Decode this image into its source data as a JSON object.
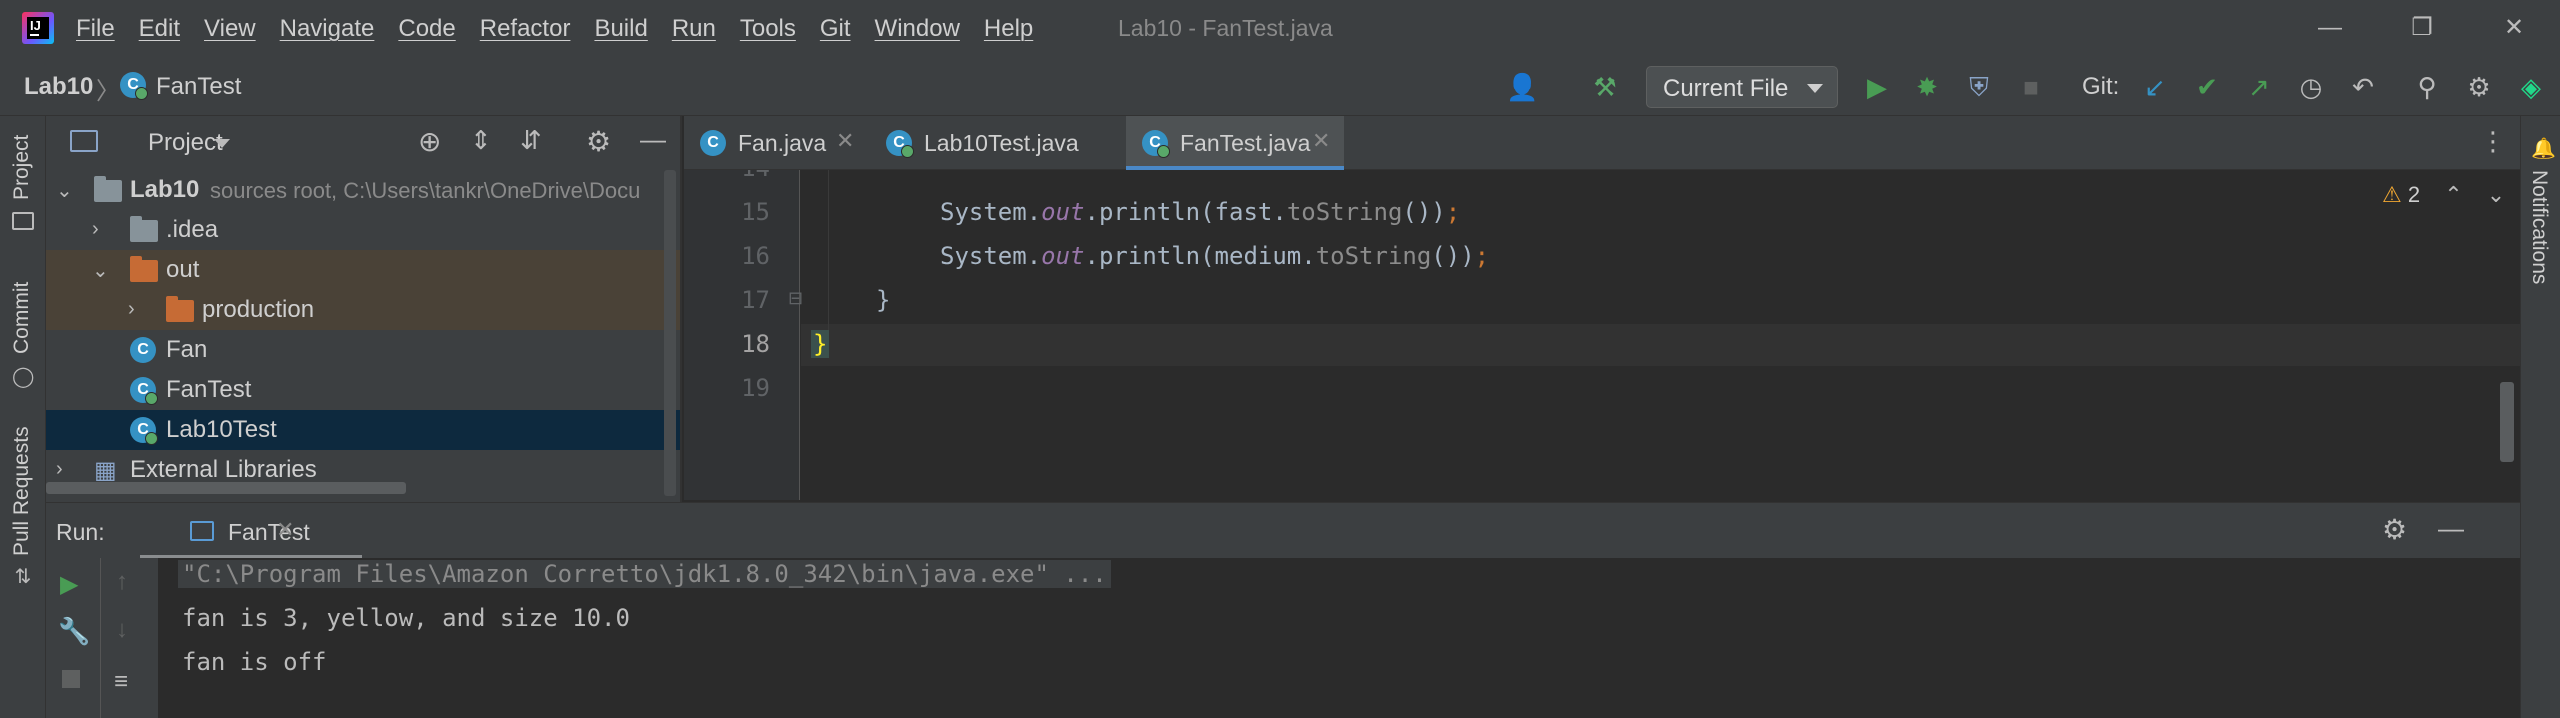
{
  "window": {
    "title": "Lab10 - FanTest.java",
    "menu": [
      "File",
      "Edit",
      "View",
      "Navigate",
      "Code",
      "Refactor",
      "Build",
      "Run",
      "Tools",
      "Git",
      "Window",
      "Help"
    ]
  },
  "navbar": {
    "project": "Lab10",
    "file": "FanTest",
    "run_config": "Current File",
    "git_label": "Git:"
  },
  "left_stripe": {
    "tabs": [
      "Project",
      "Commit",
      "Pull Requests"
    ]
  },
  "right_stripe": {
    "tabs": [
      "Notifications"
    ]
  },
  "project_panel": {
    "title": "Project",
    "tree": [
      {
        "label": "Lab10",
        "hint": "sources root,  C:\\Users\\tankr\\OneDrive\\Docu",
        "expanded": true
      },
      {
        "label": ".idea",
        "expanded": false
      },
      {
        "label": "out",
        "expanded": true
      },
      {
        "label": "production",
        "expanded": false
      },
      {
        "label": "Fan"
      },
      {
        "label": "FanTest"
      },
      {
        "label": "Lab10Test"
      },
      {
        "label": "External Libraries",
        "expanded": false
      }
    ]
  },
  "editor": {
    "tabs": [
      {
        "name": "Fan.java",
        "active": false
      },
      {
        "name": "Lab10Test.java",
        "active": false
      },
      {
        "name": "FanTest.java",
        "active": true
      }
    ],
    "warnings": "2",
    "lines": [
      {
        "number": "15",
        "pre": "System.",
        "field": "out",
        "mid": ".println(fast.",
        "method": "toString",
        "post": "())",
        "semi": ";"
      },
      {
        "number": "16",
        "pre": "System.",
        "field": "out",
        "mid": ".println(medium.",
        "method": "toString",
        "post": "())",
        "semi": ";"
      },
      {
        "number": "17",
        "text": "}"
      },
      {
        "number": "18",
        "text": "}"
      },
      {
        "number": "19",
        "text": ""
      }
    ]
  },
  "run": {
    "label": "Run:",
    "tab": "FanTest",
    "console": [
      "\"C:\\Program Files\\Amazon Corretto\\jdk1.8.0_342\\bin\\java.exe\" ...",
      "fan is 3, yellow, and size 10.0",
      "fan is off"
    ]
  },
  "colors": {
    "accent": "#4a88c7",
    "run_green": "#499c54",
    "folder_excluded": "#c66b35",
    "folder_normal": "#87939a"
  }
}
